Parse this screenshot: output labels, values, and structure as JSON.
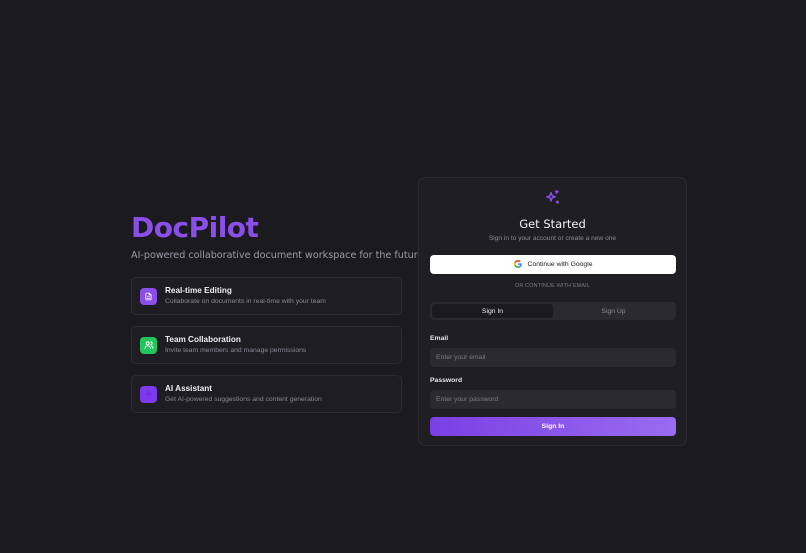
{
  "brand": {
    "name": "DocPilot",
    "tagline": "AI-powered collaborative document workspace for the future"
  },
  "features": [
    {
      "title": "Real-time Editing",
      "description": "Collaborate on documents in real-time with your team",
      "icon": "document-icon",
      "color": "#8b4ee8"
    },
    {
      "title": "Team Collaboration",
      "description": "Invite team members and manage permissions",
      "icon": "users-icon",
      "color": "#22c55e"
    },
    {
      "title": "AI Assistant",
      "description": "Get AI-powered suggestions and content generation",
      "icon": "sparkle-icon",
      "color": "#7c3aed"
    }
  ],
  "auth": {
    "title": "Get Started",
    "subtitle": "Sign in to your account or create a new one",
    "google_button": "Continue with Google",
    "divider": "OR CONTINUE WITH EMAIL",
    "tabs": [
      {
        "label": "Sign In",
        "active": true
      },
      {
        "label": "Sign Up",
        "active": false
      }
    ],
    "email_label": "Email",
    "email_placeholder": "Enter your email",
    "email_value": "",
    "password_label": "Password",
    "password_placeholder": "Enter your password",
    "password_value": "",
    "submit_label": "Sign In",
    "accent": "#8b4ee8"
  }
}
